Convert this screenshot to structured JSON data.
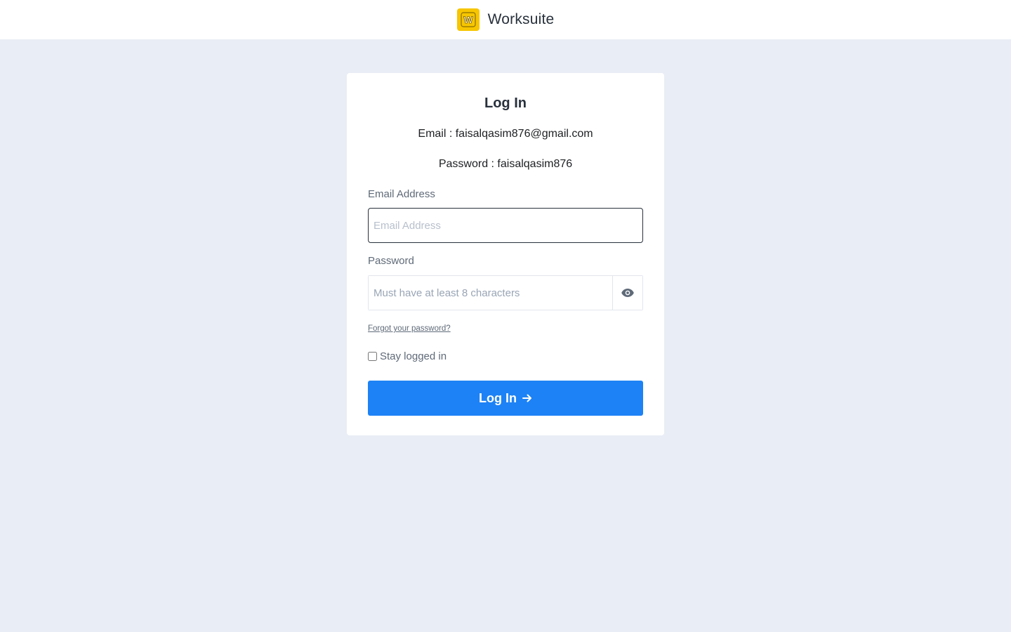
{
  "header": {
    "brand_name": "Worksuite",
    "logo_letter": "W",
    "logo_color": "#f7c600"
  },
  "login": {
    "title": "Log In",
    "email_hint": "Email : faisalqasim876@gmail.com",
    "password_hint": "Password : faisalqasim876",
    "email_label": "Email Address",
    "email_placeholder": "Email Address",
    "password_label": "Password",
    "password_placeholder": "Must have at least 8 characters",
    "forgot_link": "Forgot your password?",
    "stay_logged_in": "Stay logged in",
    "submit_label": "Log In",
    "accent_color": "#1d82f5"
  },
  "icons": {
    "eye": "eye-icon",
    "arrow": "arrow-right-icon"
  }
}
